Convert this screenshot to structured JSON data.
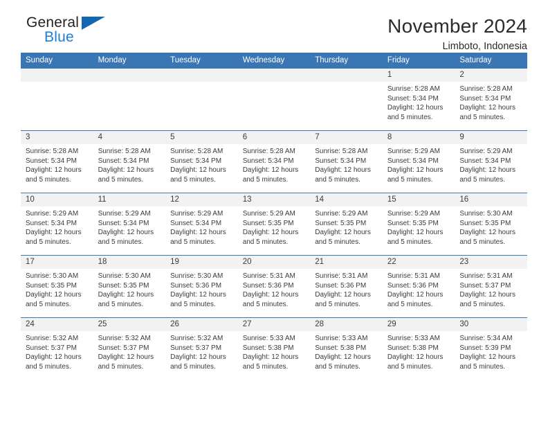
{
  "brand": {
    "line1": "General",
    "line2": "Blue",
    "mark": "triangle-logo",
    "color_primary": "#1267b0",
    "color_secondary": "#1b7fd4"
  },
  "header": {
    "title": "November 2024",
    "subtitle": "Limboto, Indonesia",
    "accent_color": "#3b76b4"
  },
  "weekday_headers": [
    "Sunday",
    "Monday",
    "Tuesday",
    "Wednesday",
    "Thursday",
    "Friday",
    "Saturday"
  ],
  "labels": {
    "sunrise_prefix": "Sunrise:",
    "sunset_prefix": "Sunset:",
    "daylight_prefix": "Daylight:"
  },
  "weeks": [
    [
      {
        "day": "",
        "sunrise": "",
        "sunset": "",
        "daylight_line1": "",
        "daylight_line2": ""
      },
      {
        "day": "",
        "sunrise": "",
        "sunset": "",
        "daylight_line1": "",
        "daylight_line2": ""
      },
      {
        "day": "",
        "sunrise": "",
        "sunset": "",
        "daylight_line1": "",
        "daylight_line2": ""
      },
      {
        "day": "",
        "sunrise": "",
        "sunset": "",
        "daylight_line1": "",
        "daylight_line2": ""
      },
      {
        "day": "",
        "sunrise": "",
        "sunset": "",
        "daylight_line1": "",
        "daylight_line2": ""
      },
      {
        "day": "1",
        "sunrise": "Sunrise: 5:28 AM",
        "sunset": "Sunset: 5:34 PM",
        "daylight_line1": "Daylight: 12 hours",
        "daylight_line2": "and 5 minutes."
      },
      {
        "day": "2",
        "sunrise": "Sunrise: 5:28 AM",
        "sunset": "Sunset: 5:34 PM",
        "daylight_line1": "Daylight: 12 hours",
        "daylight_line2": "and 5 minutes."
      }
    ],
    [
      {
        "day": "3",
        "sunrise": "Sunrise: 5:28 AM",
        "sunset": "Sunset: 5:34 PM",
        "daylight_line1": "Daylight: 12 hours",
        "daylight_line2": "and 5 minutes."
      },
      {
        "day": "4",
        "sunrise": "Sunrise: 5:28 AM",
        "sunset": "Sunset: 5:34 PM",
        "daylight_line1": "Daylight: 12 hours",
        "daylight_line2": "and 5 minutes."
      },
      {
        "day": "5",
        "sunrise": "Sunrise: 5:28 AM",
        "sunset": "Sunset: 5:34 PM",
        "daylight_line1": "Daylight: 12 hours",
        "daylight_line2": "and 5 minutes."
      },
      {
        "day": "6",
        "sunrise": "Sunrise: 5:28 AM",
        "sunset": "Sunset: 5:34 PM",
        "daylight_line1": "Daylight: 12 hours",
        "daylight_line2": "and 5 minutes."
      },
      {
        "day": "7",
        "sunrise": "Sunrise: 5:28 AM",
        "sunset": "Sunset: 5:34 PM",
        "daylight_line1": "Daylight: 12 hours",
        "daylight_line2": "and 5 minutes."
      },
      {
        "day": "8",
        "sunrise": "Sunrise: 5:29 AM",
        "sunset": "Sunset: 5:34 PM",
        "daylight_line1": "Daylight: 12 hours",
        "daylight_line2": "and 5 minutes."
      },
      {
        "day": "9",
        "sunrise": "Sunrise: 5:29 AM",
        "sunset": "Sunset: 5:34 PM",
        "daylight_line1": "Daylight: 12 hours",
        "daylight_line2": "and 5 minutes."
      }
    ],
    [
      {
        "day": "10",
        "sunrise": "Sunrise: 5:29 AM",
        "sunset": "Sunset: 5:34 PM",
        "daylight_line1": "Daylight: 12 hours",
        "daylight_line2": "and 5 minutes."
      },
      {
        "day": "11",
        "sunrise": "Sunrise: 5:29 AM",
        "sunset": "Sunset: 5:34 PM",
        "daylight_line1": "Daylight: 12 hours",
        "daylight_line2": "and 5 minutes."
      },
      {
        "day": "12",
        "sunrise": "Sunrise: 5:29 AM",
        "sunset": "Sunset: 5:34 PM",
        "daylight_line1": "Daylight: 12 hours",
        "daylight_line2": "and 5 minutes."
      },
      {
        "day": "13",
        "sunrise": "Sunrise: 5:29 AM",
        "sunset": "Sunset: 5:35 PM",
        "daylight_line1": "Daylight: 12 hours",
        "daylight_line2": "and 5 minutes."
      },
      {
        "day": "14",
        "sunrise": "Sunrise: 5:29 AM",
        "sunset": "Sunset: 5:35 PM",
        "daylight_line1": "Daylight: 12 hours",
        "daylight_line2": "and 5 minutes."
      },
      {
        "day": "15",
        "sunrise": "Sunrise: 5:29 AM",
        "sunset": "Sunset: 5:35 PM",
        "daylight_line1": "Daylight: 12 hours",
        "daylight_line2": "and 5 minutes."
      },
      {
        "day": "16",
        "sunrise": "Sunrise: 5:30 AM",
        "sunset": "Sunset: 5:35 PM",
        "daylight_line1": "Daylight: 12 hours",
        "daylight_line2": "and 5 minutes."
      }
    ],
    [
      {
        "day": "17",
        "sunrise": "Sunrise: 5:30 AM",
        "sunset": "Sunset: 5:35 PM",
        "daylight_line1": "Daylight: 12 hours",
        "daylight_line2": "and 5 minutes."
      },
      {
        "day": "18",
        "sunrise": "Sunrise: 5:30 AM",
        "sunset": "Sunset: 5:35 PM",
        "daylight_line1": "Daylight: 12 hours",
        "daylight_line2": "and 5 minutes."
      },
      {
        "day": "19",
        "sunrise": "Sunrise: 5:30 AM",
        "sunset": "Sunset: 5:36 PM",
        "daylight_line1": "Daylight: 12 hours",
        "daylight_line2": "and 5 minutes."
      },
      {
        "day": "20",
        "sunrise": "Sunrise: 5:31 AM",
        "sunset": "Sunset: 5:36 PM",
        "daylight_line1": "Daylight: 12 hours",
        "daylight_line2": "and 5 minutes."
      },
      {
        "day": "21",
        "sunrise": "Sunrise: 5:31 AM",
        "sunset": "Sunset: 5:36 PM",
        "daylight_line1": "Daylight: 12 hours",
        "daylight_line2": "and 5 minutes."
      },
      {
        "day": "22",
        "sunrise": "Sunrise: 5:31 AM",
        "sunset": "Sunset: 5:36 PM",
        "daylight_line1": "Daylight: 12 hours",
        "daylight_line2": "and 5 minutes."
      },
      {
        "day": "23",
        "sunrise": "Sunrise: 5:31 AM",
        "sunset": "Sunset: 5:37 PM",
        "daylight_line1": "Daylight: 12 hours",
        "daylight_line2": "and 5 minutes."
      }
    ],
    [
      {
        "day": "24",
        "sunrise": "Sunrise: 5:32 AM",
        "sunset": "Sunset: 5:37 PM",
        "daylight_line1": "Daylight: 12 hours",
        "daylight_line2": "and 5 minutes."
      },
      {
        "day": "25",
        "sunrise": "Sunrise: 5:32 AM",
        "sunset": "Sunset: 5:37 PM",
        "daylight_line1": "Daylight: 12 hours",
        "daylight_line2": "and 5 minutes."
      },
      {
        "day": "26",
        "sunrise": "Sunrise: 5:32 AM",
        "sunset": "Sunset: 5:37 PM",
        "daylight_line1": "Daylight: 12 hours",
        "daylight_line2": "and 5 minutes."
      },
      {
        "day": "27",
        "sunrise": "Sunrise: 5:33 AM",
        "sunset": "Sunset: 5:38 PM",
        "daylight_line1": "Daylight: 12 hours",
        "daylight_line2": "and 5 minutes."
      },
      {
        "day": "28",
        "sunrise": "Sunrise: 5:33 AM",
        "sunset": "Sunset: 5:38 PM",
        "daylight_line1": "Daylight: 12 hours",
        "daylight_line2": "and 5 minutes."
      },
      {
        "day": "29",
        "sunrise": "Sunrise: 5:33 AM",
        "sunset": "Sunset: 5:38 PM",
        "daylight_line1": "Daylight: 12 hours",
        "daylight_line2": "and 5 minutes."
      },
      {
        "day": "30",
        "sunrise": "Sunrise: 5:34 AM",
        "sunset": "Sunset: 5:39 PM",
        "daylight_line1": "Daylight: 12 hours",
        "daylight_line2": "and 5 minutes."
      }
    ]
  ]
}
